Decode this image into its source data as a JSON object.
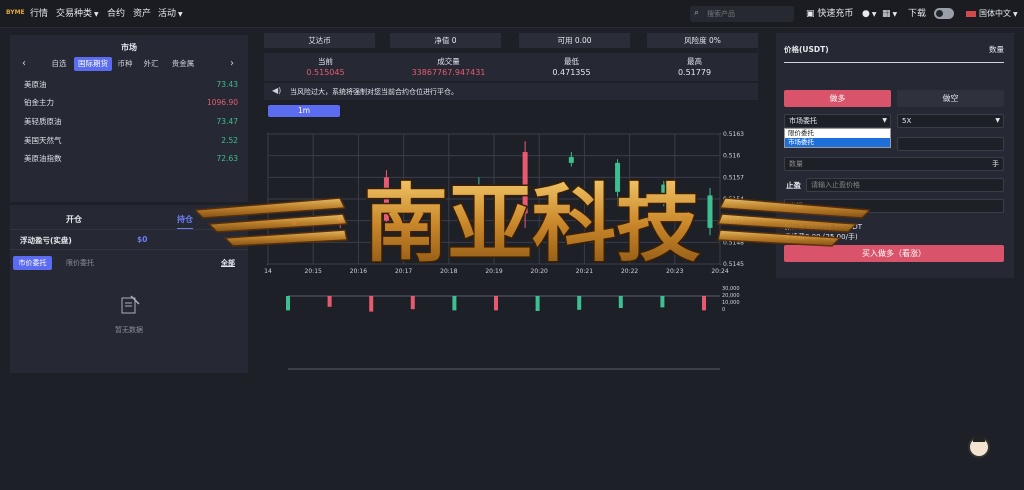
{
  "nav": {
    "logo": "BYME",
    "items": [
      "行情",
      "交易种类",
      "合约",
      "资产",
      "活动"
    ],
    "search_placeholder": "搜索产品",
    "quick_deposit": "快速充币",
    "download": "下载",
    "language": "国体中文"
  },
  "market": {
    "title": "市场",
    "tabs": [
      "自选",
      "国际期货",
      "币种",
      "外汇",
      "贵金属"
    ],
    "active_tab": "国际期货",
    "rows": [
      {
        "name": "美原油",
        "value": "73.43",
        "dir": "up"
      },
      {
        "name": "铂金主力",
        "value": "1096.90",
        "dir": "dn"
      },
      {
        "name": "美轻质原油",
        "value": "73.47",
        "dir": "up"
      },
      {
        "name": "美国天然气",
        "value": "2.52",
        "dir": "up"
      },
      {
        "name": "美原油指数",
        "value": "72.63",
        "dir": "up"
      }
    ]
  },
  "positions": {
    "tabs": [
      "开仓",
      "持仓"
    ],
    "floating_label": "浮动盈亏(实盘)",
    "floating_value": "$0",
    "order_tabs": [
      "市价委托",
      "限价委托"
    ],
    "all_label": "全部",
    "empty_text": "暂无数据"
  },
  "ticker": {
    "symbol": "艾达币",
    "net_value": "净值 0",
    "available": "可用 0.00",
    "risk": "风险度 0%",
    "stats": [
      {
        "label": "当前",
        "value": "0.515045",
        "color": "#e85a70"
      },
      {
        "label": "成交量",
        "value": "33867767.947431",
        "color": "#e85a70"
      },
      {
        "label": "最低",
        "value": "0.471355",
        "color": "#e6e8ee"
      },
      {
        "label": "最高",
        "value": "0.51779",
        "color": "#e6e8ee"
      }
    ],
    "notice": "当风险过大，系统将强制对您当前合约仓位进行平仓。",
    "interval": "1m"
  },
  "chart_data": {
    "type": "candlestick",
    "x": [
      "14",
      "20:15",
      "20:16",
      "20:17",
      "20:18",
      "20:19",
      "20:20",
      "20:21",
      "20:22",
      "20:23",
      "20:24"
    ],
    "y_ticks": [
      "0.5163",
      "0.516",
      "0.5157",
      "0.5154",
      "0.5151",
      "0.5148",
      "0.5145"
    ],
    "candles": [
      {
        "o": 0.51504,
        "c": 0.51508,
        "h": 0.51512,
        "l": 0.515,
        "dir": "dn"
      },
      {
        "o": 0.51508,
        "c": 0.51514,
        "h": 0.5152,
        "l": 0.515,
        "dir": "dn"
      },
      {
        "o": 0.5151,
        "c": 0.5157,
        "h": 0.5158,
        "l": 0.515,
        "dir": "dn"
      },
      {
        "o": 0.51505,
        "c": 0.5151,
        "h": 0.5152,
        "l": 0.51495,
        "dir": "dn"
      },
      {
        "o": 0.5156,
        "c": 0.515,
        "h": 0.5157,
        "l": 0.5149,
        "dir": "up"
      },
      {
        "o": 0.5152,
        "c": 0.51605,
        "h": 0.5162,
        "l": 0.515,
        "dir": "dn"
      },
      {
        "o": 0.51598,
        "c": 0.5159,
        "h": 0.51605,
        "l": 0.51585,
        "dir": "up"
      },
      {
        "o": 0.5159,
        "c": 0.5155,
        "h": 0.51595,
        "l": 0.5153,
        "dir": "up"
      },
      {
        "o": 0.5156,
        "c": 0.5154,
        "h": 0.51565,
        "l": 0.5153,
        "dir": "up"
      },
      {
        "o": 0.51545,
        "c": 0.515,
        "h": 0.51555,
        "l": 0.5149,
        "dir": "up"
      }
    ],
    "volume_ticks": [
      "30,000",
      "20,000",
      "10,000",
      "0"
    ],
    "volumes": [
      {
        "v": 12000,
        "dir": "up"
      },
      {
        "v": 9000,
        "dir": "dn"
      },
      {
        "v": 13000,
        "dir": "dn"
      },
      {
        "v": 11000,
        "dir": "dn"
      },
      {
        "v": 12000,
        "dir": "up"
      },
      {
        "v": 12000,
        "dir": "dn"
      },
      {
        "v": 12500,
        "dir": "up"
      },
      {
        "v": 11500,
        "dir": "up"
      },
      {
        "v": 10000,
        "dir": "up"
      },
      {
        "v": 9500,
        "dir": "up"
      },
      {
        "v": 12000,
        "dir": "dn"
      }
    ],
    "colors": {
      "up": "#3ebf8f",
      "dn": "#e85a70"
    }
  },
  "order": {
    "price_label": "价格(USDT)",
    "qty_label": "数量",
    "buy_long": "做多",
    "sell_short": "做空",
    "order_type": "市场委托",
    "leverage": "5X",
    "dropdown_options": [
      "限价委托",
      "市场委托"
    ],
    "qty_placeholder": "数量",
    "qty_unit": "手",
    "tp_label": "止盈",
    "tp_placeholder": "请输入止盈价格",
    "sl_placeholder": "止损",
    "margin_text": "保证金999999.99USDT",
    "fee_text": "手续费0.00 (25.00/手)",
    "submit": "买入做多（看涨）"
  },
  "watermark": "南亚科技"
}
